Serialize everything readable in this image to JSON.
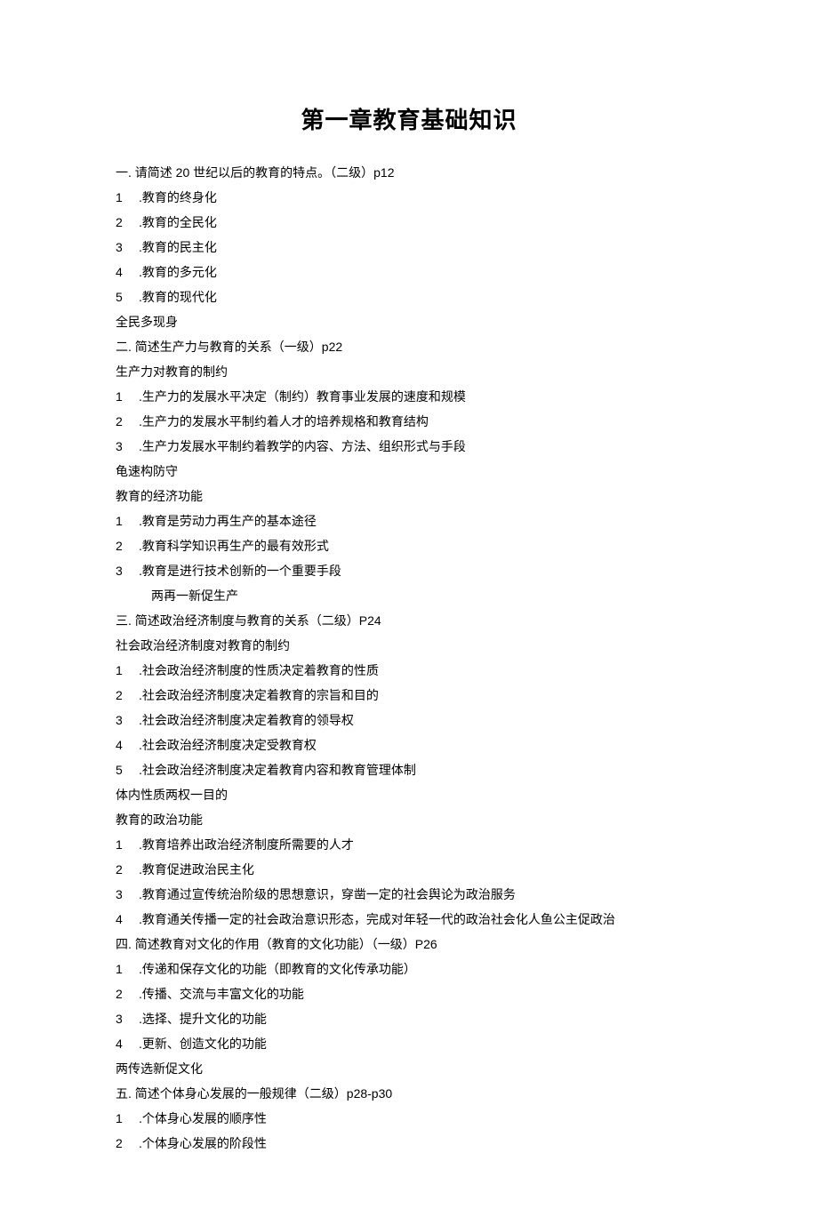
{
  "title": "第一章教育基础知识",
  "sections": [
    {
      "type": "line",
      "text": "一. 请简述 20 世纪以后的教育的特点。（二级）p12"
    },
    {
      "type": "num",
      "num": "1",
      "text": " .教育的终身化"
    },
    {
      "type": "num",
      "num": "2",
      "text": " .教育的全民化"
    },
    {
      "type": "num",
      "num": "3",
      "text": " .教育的民主化"
    },
    {
      "type": "num",
      "num": "4",
      "text": " .教育的多元化"
    },
    {
      "type": "num",
      "num": "5",
      "text": " .教育的现代化"
    },
    {
      "type": "line",
      "text": "全民多现身"
    },
    {
      "type": "line",
      "text": "二. 简述生产力与教育的关系（一级）p22"
    },
    {
      "type": "line",
      "text": "生产力对教育的制约"
    },
    {
      "type": "num",
      "num": "1",
      "text": " .生产力的发展水平决定（制约）教育事业发展的速度和规模"
    },
    {
      "type": "num",
      "num": "2",
      "text": " .生产力的发展水平制约着人才的培养规格和教育结构"
    },
    {
      "type": "num",
      "num": "3",
      "text": " .生产力发展水平制约着教学的内容、方法、组织形式与手段"
    },
    {
      "type": "line",
      "text": "龟速构防守"
    },
    {
      "type": "line",
      "text": "教育的经济功能"
    },
    {
      "type": "num",
      "num": "1",
      "text": " .教育是劳动力再生产的基本途径"
    },
    {
      "type": "num",
      "num": "2",
      "text": " .教育科学知识再生产的最有效形式"
    },
    {
      "type": "num",
      "num": "3",
      "text": " .教育是进行技术创新的一个重要手段"
    },
    {
      "type": "indent",
      "text": "两再一新促生产"
    },
    {
      "type": "line",
      "text": "三. 简述政治经济制度与教育的关系（二级）P24"
    },
    {
      "type": "line",
      "text": "社会政治经济制度对教育的制约"
    },
    {
      "type": "num",
      "num": "1",
      "text": " .社会政治经济制度的性质决定着教育的性质"
    },
    {
      "type": "num",
      "num": "2",
      "text": " .社会政治经济制度决定着教育的宗旨和目的"
    },
    {
      "type": "num",
      "num": "3",
      "text": " .社会政治经济制度决定着教育的领导权"
    },
    {
      "type": "num",
      "num": "4",
      "text": " .社会政治经济制度决定受教育权"
    },
    {
      "type": "num",
      "num": "5",
      "text": " .社会政治经济制度决定着教育内容和教育管理体制"
    },
    {
      "type": "line",
      "text": "体内性质两权一目的"
    },
    {
      "type": "line",
      "text": "教育的政治功能"
    },
    {
      "type": "num",
      "num": "1",
      "text": " .教育培养出政治经济制度所需要的人才"
    },
    {
      "type": "num",
      "num": "2",
      "text": " .教育促进政治民主化"
    },
    {
      "type": "num",
      "num": "3",
      "text": " .教育通过宣传统治阶级的思想意识，穿凿一定的社会舆论为政治服务"
    },
    {
      "type": "num",
      "num": "4",
      "text": " .教育通关传播一定的社会政治意识形态，完成对年轻一代的政治社会化人鱼公主促政治"
    },
    {
      "type": "line",
      "text": "四. 简述教育对文化的作用（教育的文化功能）（一级）P26"
    },
    {
      "type": "num",
      "num": "1",
      "text": " .传递和保存文化的功能（即教育的文化传承功能）"
    },
    {
      "type": "num",
      "num": "2",
      "text": " .传播、交流与丰富文化的功能"
    },
    {
      "type": "num",
      "num": "3",
      "text": " .选择、提升文化的功能"
    },
    {
      "type": "num",
      "num": "4",
      "text": " .更新、创造文化的功能"
    },
    {
      "type": "line",
      "text": "两传选新促文化"
    },
    {
      "type": "line",
      "text": "五. 简述个体身心发展的一般规律（二级）p28-p30"
    },
    {
      "type": "num",
      "num": "1",
      "text": " .个体身心发展的顺序性"
    },
    {
      "type": "num",
      "num": "2",
      "text": " .个体身心发展的阶段性"
    }
  ]
}
